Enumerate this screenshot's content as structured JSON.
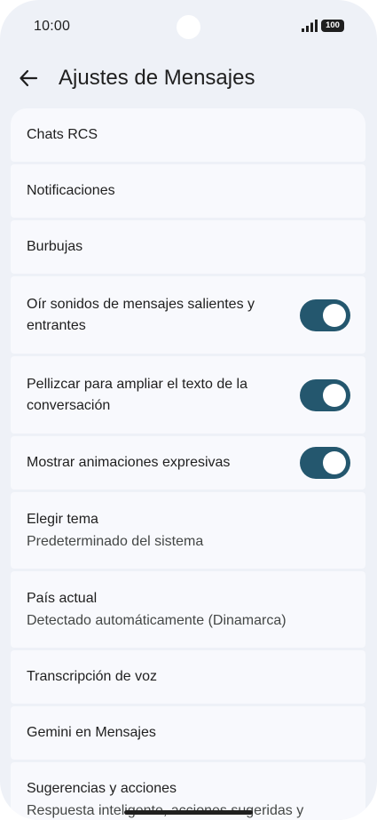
{
  "status_bar": {
    "time": "10:00",
    "battery": "100",
    "icons": [
      "signal-icon",
      "battery-icon"
    ]
  },
  "app_bar": {
    "title": "Ajustes de Mensajes",
    "back_icon": "arrow-back-icon"
  },
  "settings": [
    {
      "label": "Chats RCS"
    },
    {
      "label": "Notificaciones"
    },
    {
      "label": "Burbujas"
    },
    {
      "label": "Oír sonidos de mensajes salientes y entrantes",
      "toggle": true
    },
    {
      "label": "Pellizcar para ampliar el texto de la conversación",
      "toggle": true
    },
    {
      "label": "Mostrar animaciones expresivas",
      "toggle": true
    },
    {
      "label": "Elegir tema",
      "sub": "Predeterminado del sistema"
    },
    {
      "label": "País actual",
      "sub": "Detectado automáticamente (Dinamarca)"
    },
    {
      "label": "Transcripción de voz"
    },
    {
      "label": "Gemini en Mensajes"
    },
    {
      "label": "Sugerencias y acciones",
      "sub": "Respuesta inteligente, acciones sugeridas y"
    }
  ],
  "colors": {
    "background": "#eef1f7",
    "card": "#f8f9fd",
    "toggle_on": "#24576e",
    "text_primary": "#1f1f1f",
    "text_secondary": "#444746"
  }
}
